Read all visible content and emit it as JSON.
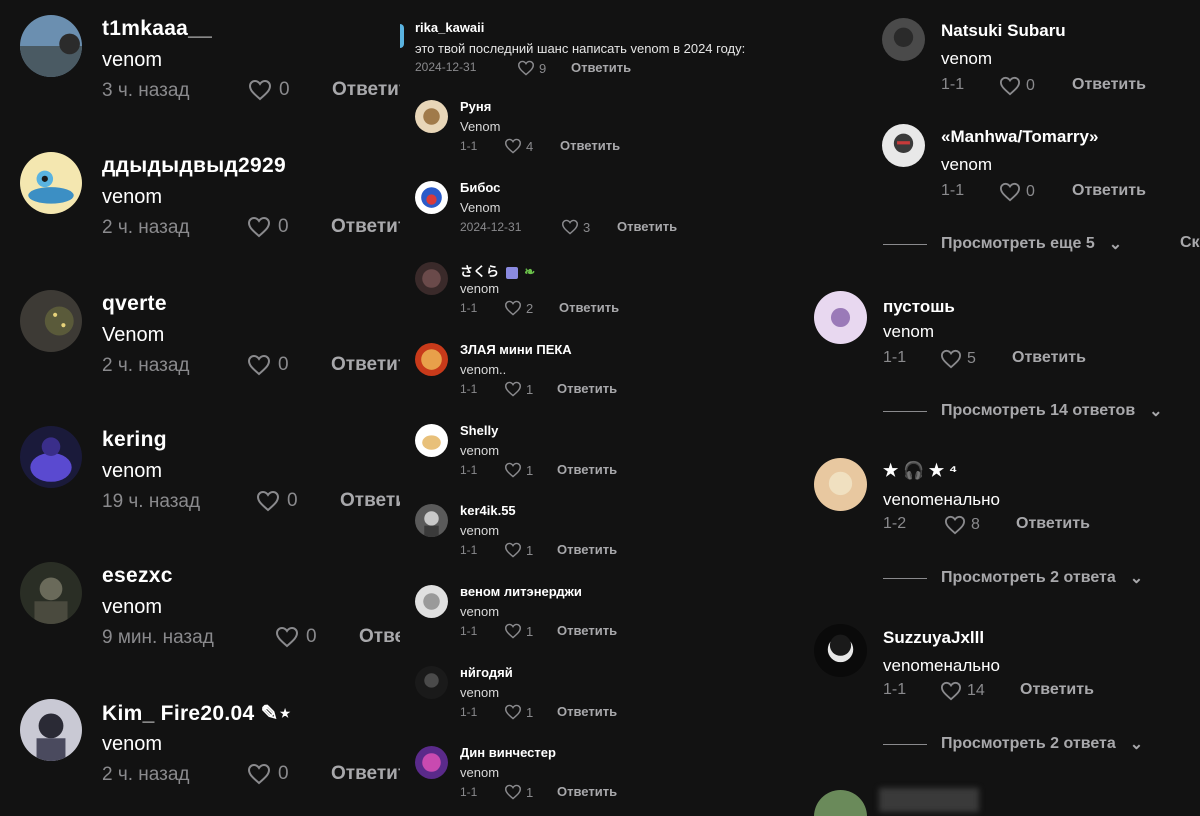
{
  "left": {
    "items": [
      {
        "name": "t1mkaaa__",
        "text": "venom",
        "time": "3 ч. назад",
        "likes": "0",
        "reply": "Ответить"
      },
      {
        "name": "ддыдыдвыд2929",
        "text": "venom",
        "time": "2 ч. назад",
        "likes": "0",
        "reply": "Ответить"
      },
      {
        "name": "qverte",
        "text": "Venom",
        "time": "2 ч. назад",
        "likes": "0",
        "reply": "Ответить"
      },
      {
        "name": "kering",
        "text": "venom",
        "time": "19 ч. назад",
        "likes": "0",
        "reply": "Ответить"
      },
      {
        "name": "esezxc",
        "text": "venom",
        "time": "9 мин. назад",
        "likes": "0",
        "reply": "Ответить"
      },
      {
        "name": "Kim_ Fire20.04 ✎⋆",
        "text": "venom",
        "time": "2 ч. назад",
        "likes": "0",
        "reply": "Ответить"
      }
    ]
  },
  "middle": {
    "top": {
      "name": "rika_kawaii",
      "text": "это твой последний шанс написать venom в 2024 году:",
      "date": "2024-12-31",
      "likes": "9",
      "reply": "Ответить"
    },
    "items": [
      {
        "name": "Руня",
        "text": "Venom",
        "date": "1-1",
        "likes": "4",
        "reply": "Ответить"
      },
      {
        "name": "Бибос",
        "text": "Venom",
        "date": "2024-12-31",
        "likes": "3",
        "reply": "Ответить"
      },
      {
        "name": "さくら",
        "text": "venom",
        "date": "1-1",
        "likes": "2",
        "reply": "Ответить"
      },
      {
        "name": "ЗЛАЯ мини ПЕКА",
        "text": "venom..",
        "date": "1-1",
        "likes": "1",
        "reply": "Ответить"
      },
      {
        "name": "Shelly",
        "text": "venom",
        "date": "1-1",
        "likes": "1",
        "reply": "Ответить"
      },
      {
        "name": "ker4ik.55",
        "text": "venom",
        "date": "1-1",
        "likes": "1",
        "reply": "Ответить"
      },
      {
        "name": "веном литэнерджи",
        "text": "venom",
        "date": "1-1",
        "likes": "1",
        "reply": "Ответить"
      },
      {
        "name": "нйгодяй",
        "text": "venom",
        "date": "1-1",
        "likes": "1",
        "reply": "Ответить"
      },
      {
        "name": "Дин винчестер",
        "text": "venom",
        "date": "1-1",
        "likes": "1",
        "reply": "Ответить"
      }
    ]
  },
  "right": {
    "replies": [
      {
        "name": "Natsuki Subaru",
        "text": "venom",
        "date": "1-1",
        "likes": "0",
        "reply": "Ответить"
      },
      {
        "name": "«Manhwa/Tomarry»",
        "text": "venom",
        "date": "1-1",
        "likes": "0",
        "reply": "Ответить"
      }
    ],
    "view_more_1": "Просмотреть еще 5",
    "cut_text": "Ск",
    "items": [
      {
        "name": "пустошь",
        "text": "venom",
        "date": "1-1",
        "likes": "5",
        "reply": "Ответить",
        "view_more": "Просмотреть 14 ответов"
      },
      {
        "name": "★ 🎧 ★ ⁴",
        "text": "venomенально",
        "date": "1-2",
        "likes": "8",
        "reply": "Ответить",
        "view_more": "Просмотреть 2 ответа"
      },
      {
        "name": "SuzzuyaJxlll",
        "text": "venomенально",
        "date": "1-1",
        "likes": "14",
        "reply": "Ответить",
        "view_more": "Просмотреть 2 ответа"
      }
    ]
  },
  "colors": {
    "background": "#121212",
    "muted": "#8a8a8d",
    "reply": "#a8a8ab",
    "text": "#ffffff"
  }
}
